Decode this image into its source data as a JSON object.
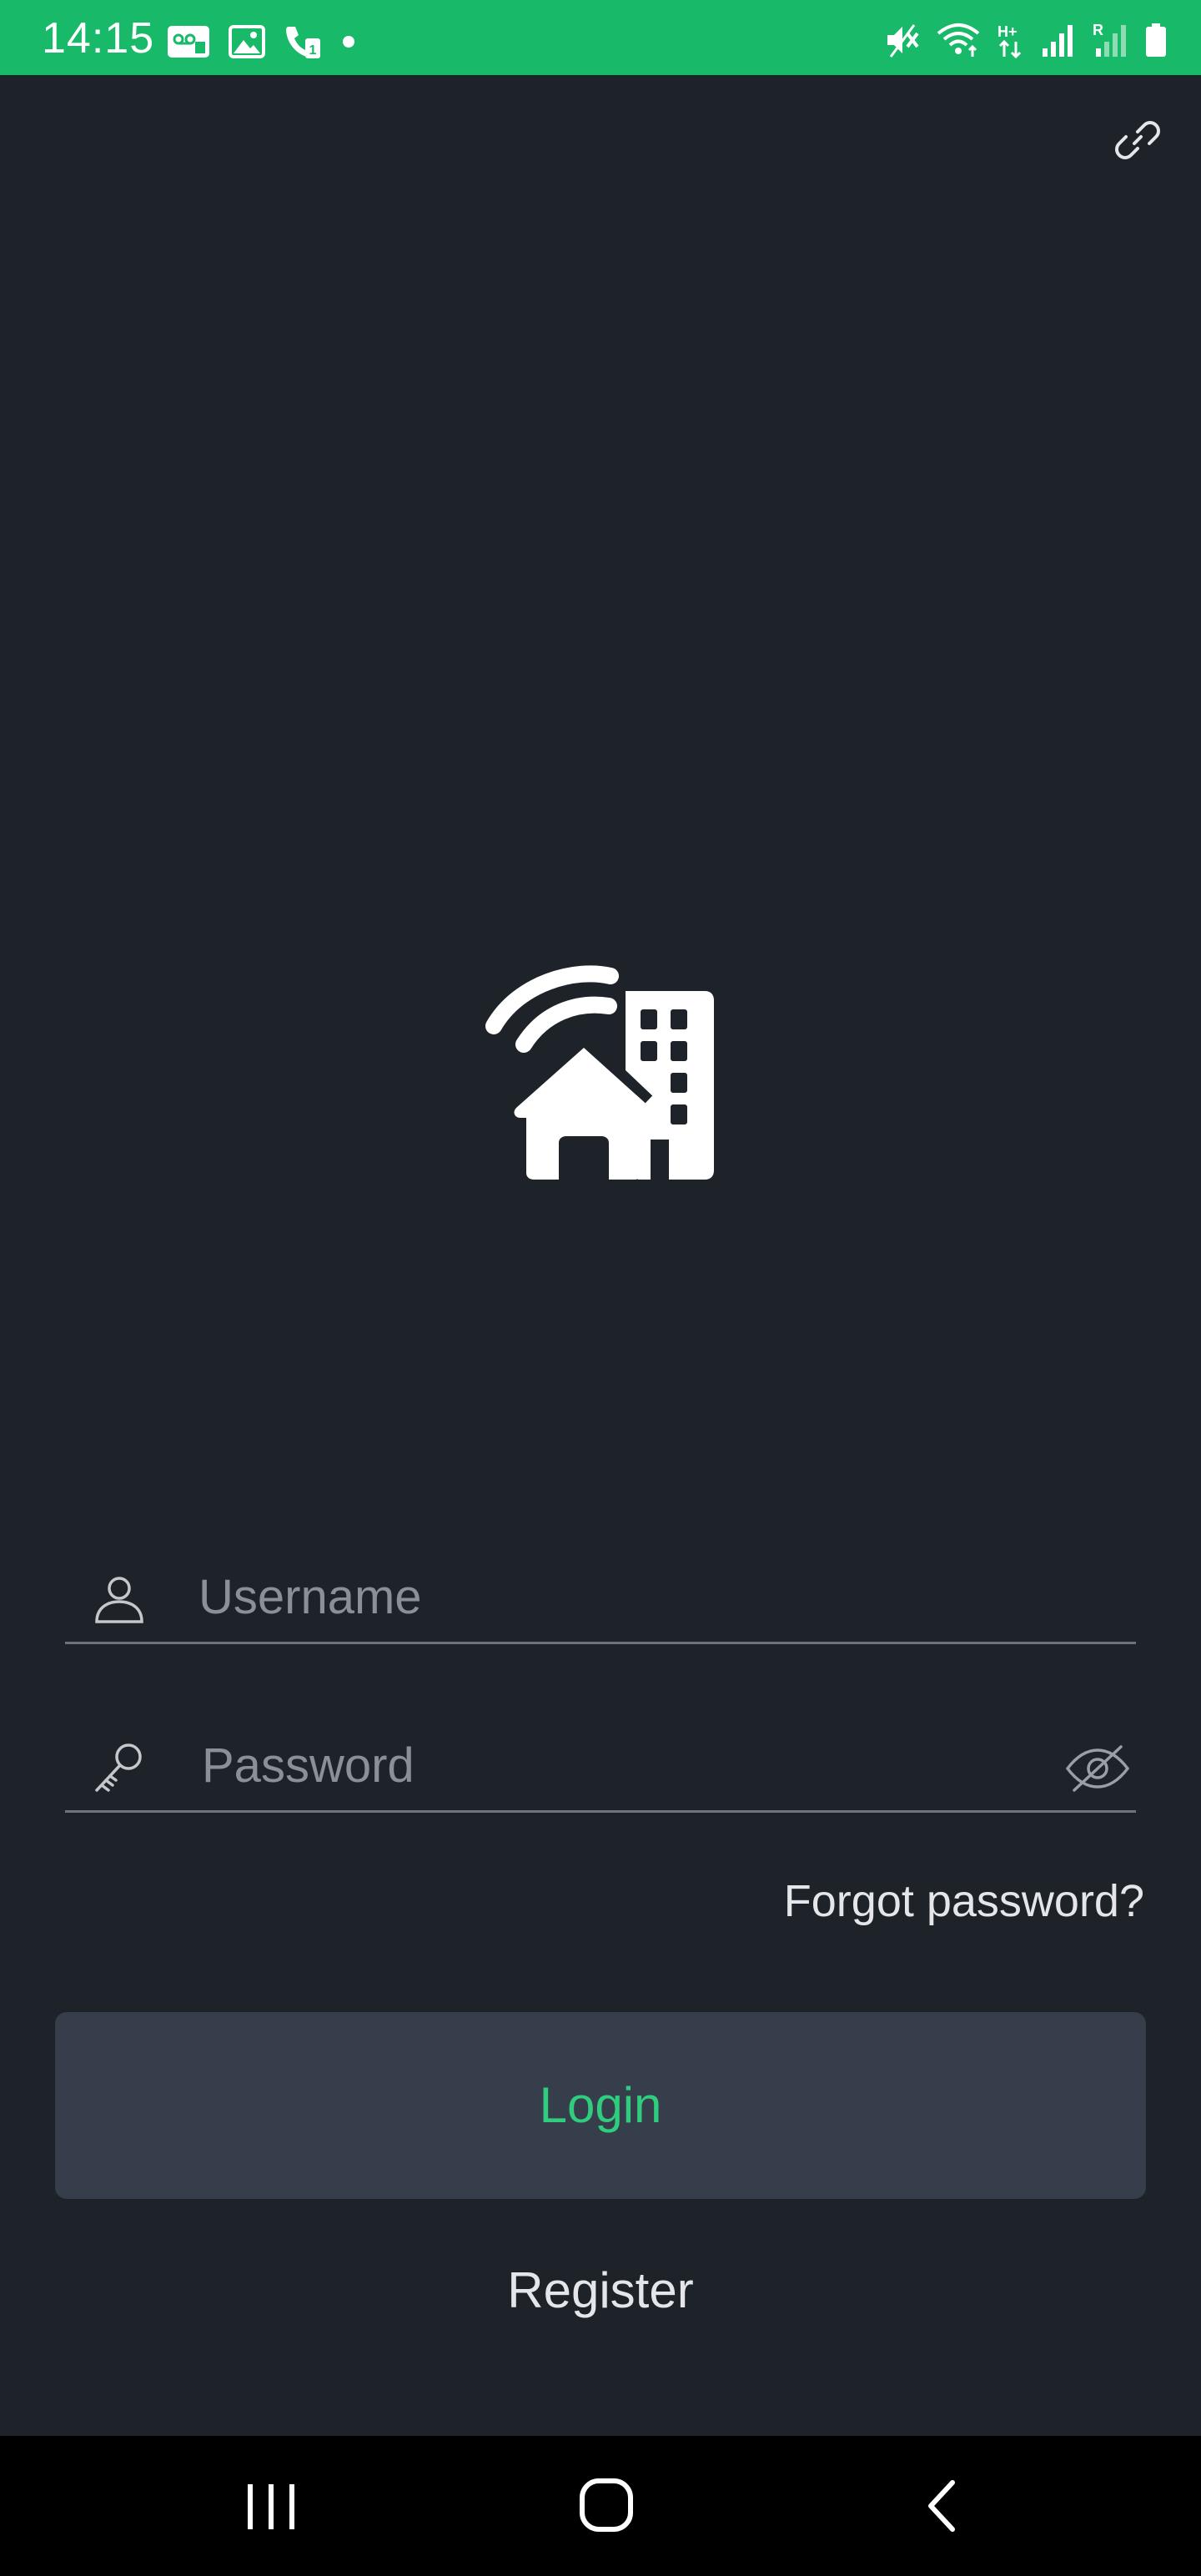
{
  "status_bar": {
    "time": "14:15",
    "background_color": "#18b968",
    "left_icons": [
      "voicemail-icon",
      "image-icon",
      "call-sim1-icon",
      "notification-dot-icon"
    ],
    "right_icons": [
      "mute-vibrate-icon",
      "wifi-icon",
      "h-plus-data-icon",
      "signal-icon",
      "signal-roaming-icon",
      "battery-icon"
    ],
    "data_indicator": "H+",
    "roaming_indicator": "R"
  },
  "top_action": {
    "icon": "link-icon"
  },
  "logo": {
    "icon": "smart-home-wifi-building-icon"
  },
  "form": {
    "username_placeholder": "Username",
    "username_icon": "user-icon",
    "password_placeholder": "Password",
    "password_icon": "key-icon",
    "password_toggle_icon": "eye-off-icon",
    "forgot_password": "Forgot password?",
    "login_label": "Login",
    "register_label": "Register"
  },
  "colors": {
    "background": "#1e2229",
    "accent": "#2fcd7d",
    "button_bg": "#363e4b",
    "placeholder": "#8b9098"
  },
  "nav_bar": {
    "buttons": [
      "recents-icon",
      "home-icon",
      "back-icon"
    ]
  }
}
